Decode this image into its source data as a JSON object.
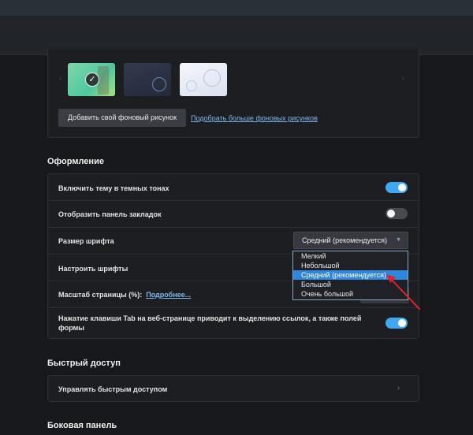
{
  "backgrounds": {
    "add_button": "Добавить свой фоновый рисунок",
    "more_link": "Подобрать больше фоновых рисунков",
    "selected_check": "✓",
    "prev_arrow": "‹",
    "next_arrow": "›"
  },
  "appearance": {
    "title": "Оформление",
    "dark_theme": {
      "label": "Включить тему в темных тонах",
      "enabled": true
    },
    "bookmarks_bar": {
      "label": "Отобразить панель закладок",
      "enabled": false
    },
    "font_size": {
      "label": "Размер шрифта",
      "selected": "Средний (рекомендуется)",
      "options": [
        "Мелкий",
        "Небольшой",
        "Средний (рекомендуется)",
        "Большой",
        "Очень большой"
      ]
    },
    "customize_fonts": {
      "label": "Настроить шрифты"
    },
    "page_zoom": {
      "label": "Масштаб страницы (%):",
      "link": "Подробнее..."
    },
    "tab_highlight": {
      "label": "Нажатие клавиши Tab на веб-странице приводит к выделению ссылок, а также полей формы",
      "enabled": true
    }
  },
  "quick_access": {
    "title": "Быстрый доступ",
    "manage": "Управлять быстрым доступом",
    "chevron": "›"
  },
  "sidebar": {
    "title": "Боковая панель"
  },
  "colors": {
    "accent": "#3fa8f0",
    "link": "#7fb8ef",
    "selected_option": "#2e86de",
    "annotation_arrow": "#e0202a"
  }
}
